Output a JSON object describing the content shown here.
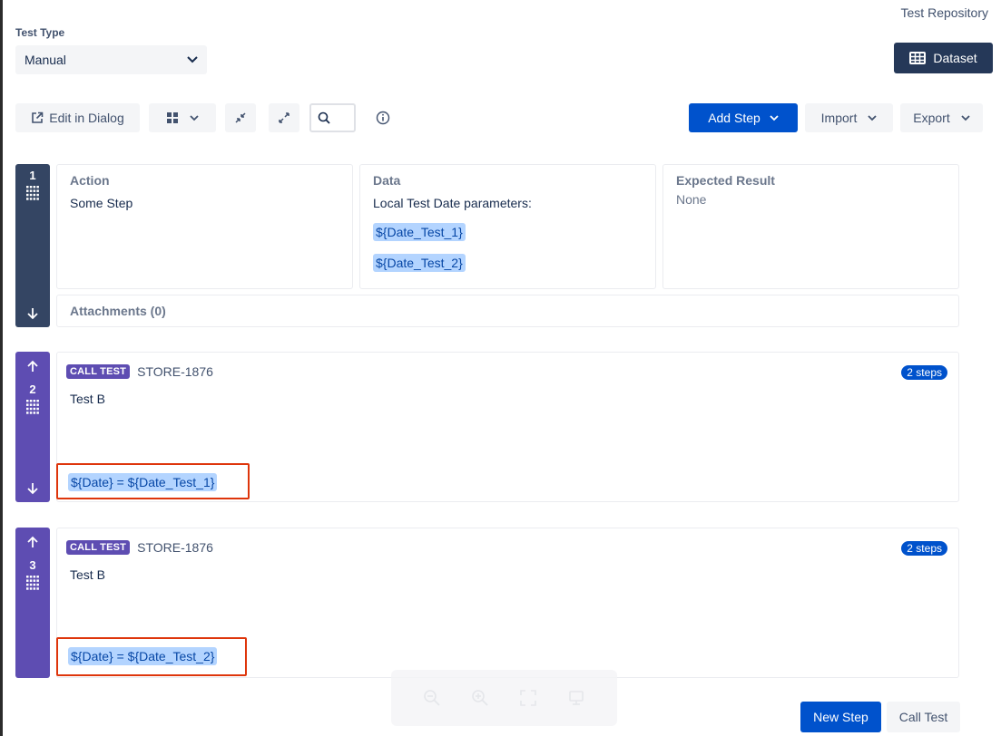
{
  "header": {
    "repo_link": "Test Repository",
    "test_type_label": "Test Type",
    "test_type_value": "Manual",
    "dataset_label": "Dataset"
  },
  "toolbar": {
    "edit_dialog_label": "Edit in Dialog",
    "add_step_label": "Add Step",
    "import_label": "Import",
    "export_label": "Export"
  },
  "step1": {
    "number": "1",
    "action_title": "Action",
    "action_text": "Some Step",
    "data_title": "Data",
    "data_text": "Local Test Date parameters:",
    "params": [
      "${Date_Test_1}",
      "${Date_Test_2}"
    ],
    "expected_title": "Expected Result",
    "expected_text": "None",
    "attachments": "Attachments (0)"
  },
  "step2": {
    "number": "2",
    "badge": "CALL TEST",
    "key": "STORE-1876",
    "name": "Test B",
    "steps_count": "2 steps",
    "param_mapping": "${Date} = ${Date_Test_1}"
  },
  "step3": {
    "number": "3",
    "badge": "CALL TEST",
    "key": "STORE-1876",
    "name": "Test B",
    "steps_count": "2 steps",
    "param_mapping": "${Date} = ${Date_Test_2}"
  },
  "footer": {
    "new_step_label": "New Step",
    "call_test_label": "Call Test"
  },
  "colors": {
    "primary": "#0052cc",
    "dark_rail": "#344563",
    "call_test_purple": "#5e4db2",
    "highlight_red": "#de350b",
    "param_bg": "#b3d4ff"
  }
}
